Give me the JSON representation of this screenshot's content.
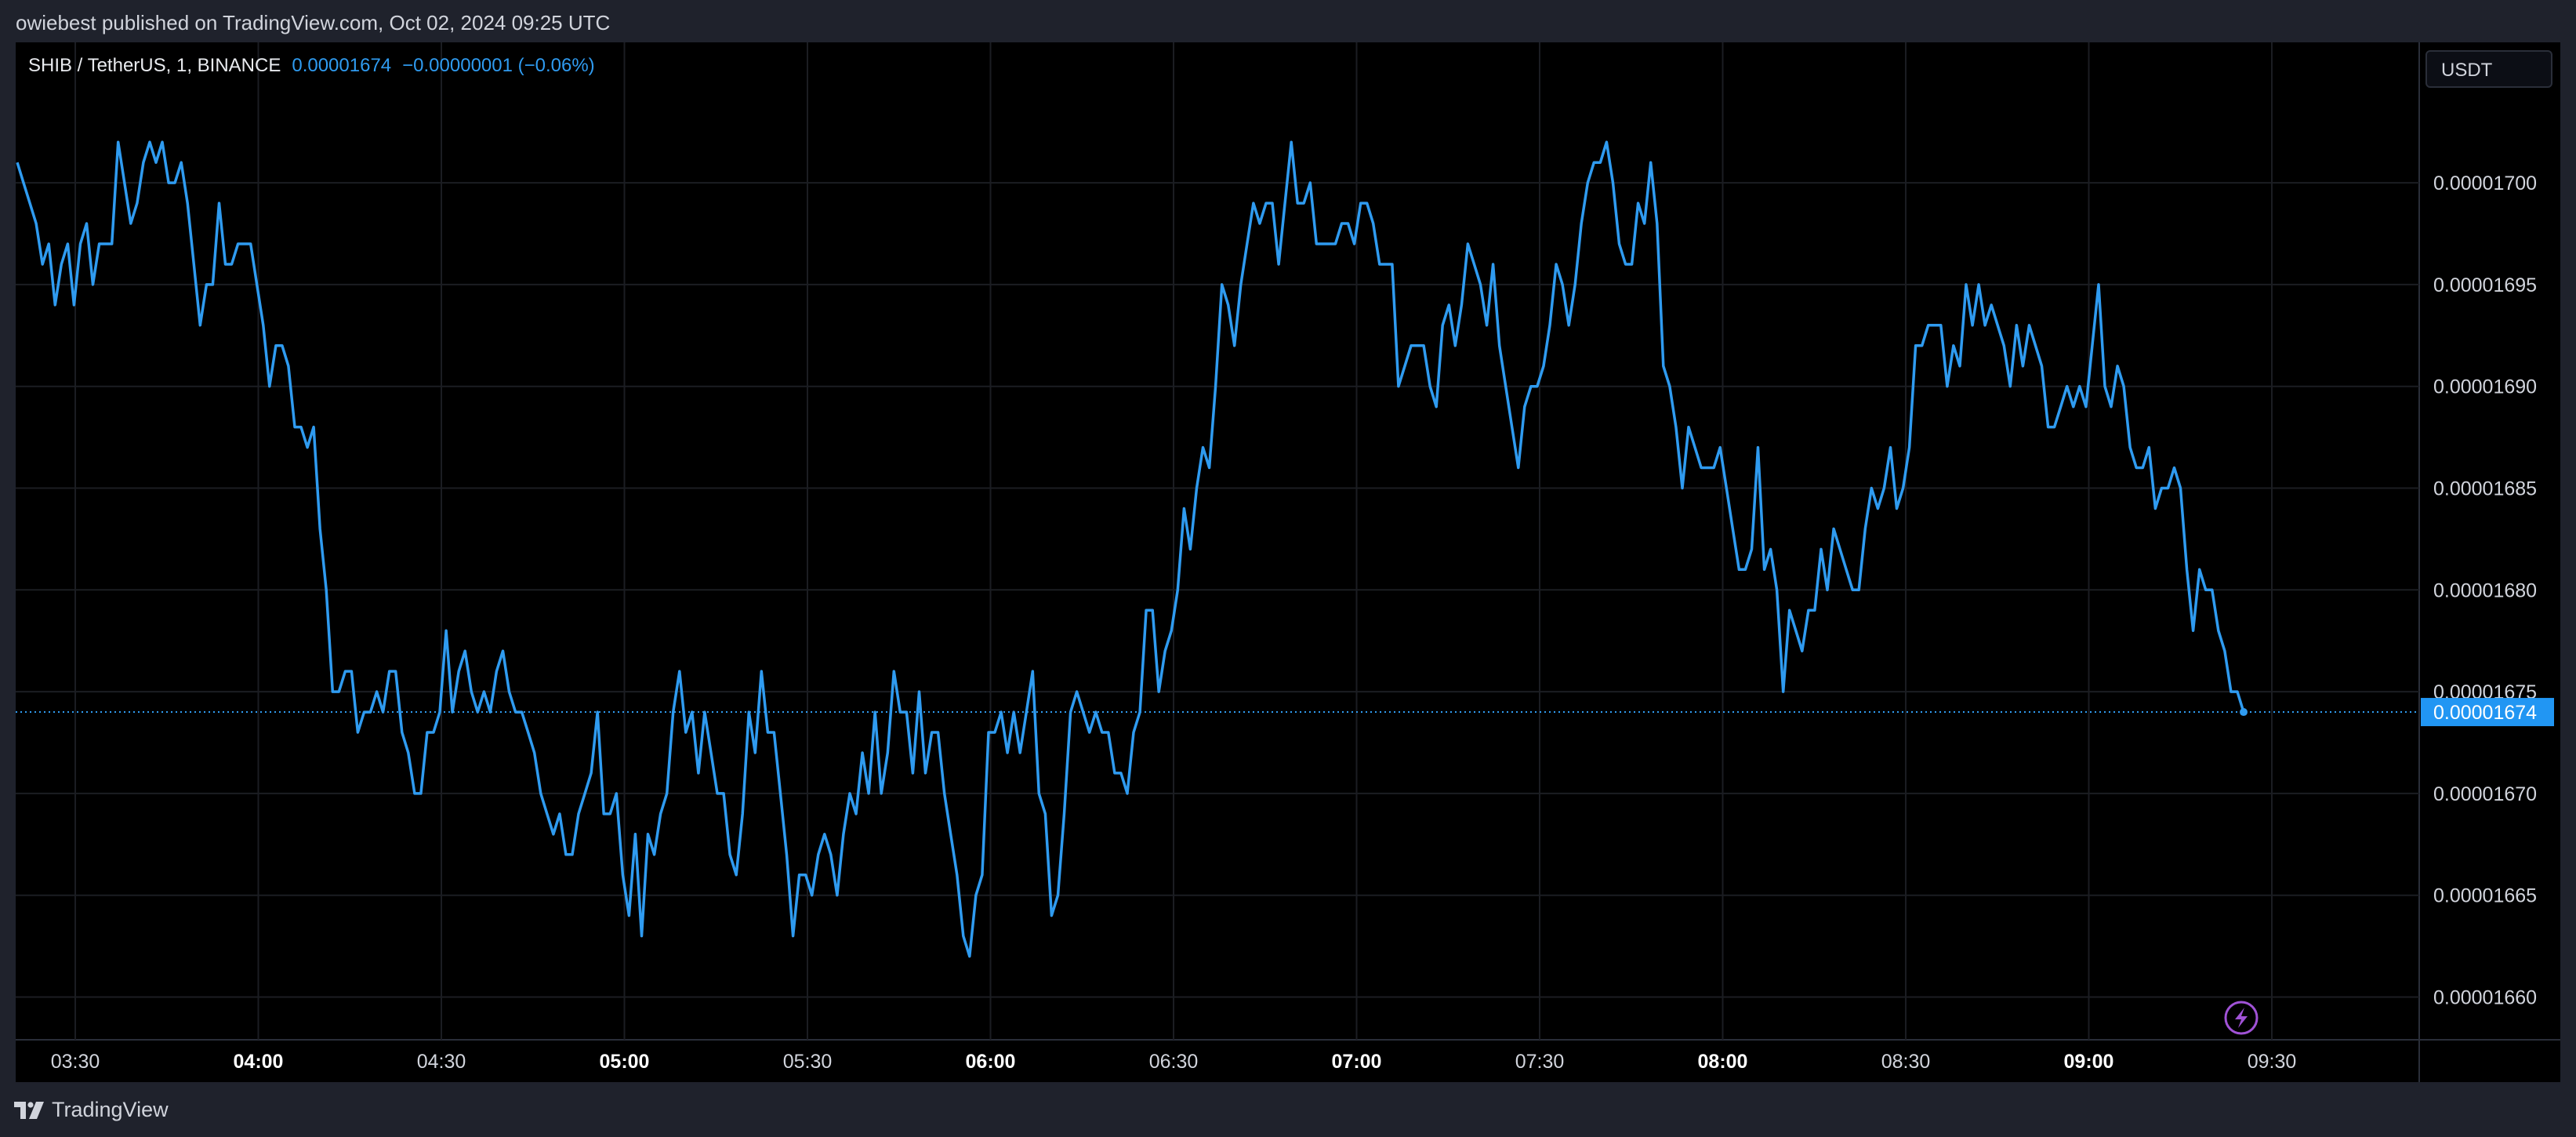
{
  "header": {
    "publisher_text": "owiebest published on TradingView.com, Oct 02, 2024 09:25 UTC"
  },
  "legend": {
    "symbol": "SHIB / TetherUS, 1, BINANCE",
    "price": "0.00001674",
    "change": "−0.00000001 (−0.06%)"
  },
  "currency": "USDT",
  "footer": {
    "brand": "TradingView"
  },
  "colors": {
    "line": "#2f9bf0",
    "background": "#000000",
    "grid": "#1b1d22",
    "price_tag": "#2196f3",
    "lightning": "#a052d6"
  },
  "chart_data": {
    "type": "line",
    "series": [
      {
        "values": [
          1701,
          1700,
          1699,
          1698,
          1696,
          1697,
          1694,
          1696,
          1697,
          1694,
          1697,
          1698,
          1695,
          1697,
          1697,
          1697,
          1702,
          1700,
          1698,
          1699,
          1701,
          1702,
          1701,
          1702,
          1700,
          1700,
          1701,
          1699,
          1696,
          1693,
          1695,
          1695,
          1699,
          1696,
          1696,
          1697,
          1697,
          1697,
          1695,
          1693,
          1690,
          1692,
          1692,
          1691,
          1688,
          1688,
          1687,
          1688,
          1683,
          1680,
          1675,
          1675,
          1676,
          1676,
          1673,
          1674,
          1674,
          1675,
          1674,
          1676,
          1676,
          1673,
          1672,
          1670,
          1670,
          1673,
          1673,
          1674,
          1678,
          1674,
          1676,
          1677,
          1675,
          1674,
          1675,
          1674,
          1676,
          1677,
          1675,
          1674,
          1674,
          1673,
          1672,
          1670,
          1669,
          1668,
          1669,
          1667,
          1667,
          1669,
          1670,
          1671,
          1674,
          1669,
          1669,
          1670,
          1666,
          1664,
          1668,
          1663,
          1668,
          1667,
          1669,
          1670,
          1674,
          1676,
          1673,
          1674,
          1671,
          1674,
          1672,
          1670,
          1670,
          1667,
          1666,
          1669,
          1674,
          1672,
          1676,
          1673,
          1673,
          1670,
          1667,
          1663,
          1666,
          1666,
          1665,
          1667,
          1668,
          1667,
          1665,
          1668,
          1670,
          1669,
          1672,
          1670,
          1674,
          1670,
          1672,
          1676,
          1674,
          1674,
          1671,
          1675,
          1671,
          1673,
          1673,
          1670,
          1668,
          1666,
          1663,
          1662,
          1665,
          1666,
          1673,
          1673,
          1674,
          1672,
          1674,
          1672,
          1674,
          1676,
          1670,
          1669,
          1664,
          1665,
          1669,
          1674,
          1675,
          1674,
          1673,
          1674,
          1673,
          1673,
          1671,
          1671,
          1670,
          1673,
          1674,
          1679,
          1679,
          1675,
          1677,
          1678,
          1680,
          1684,
          1682,
          1685,
          1687,
          1686,
          1690,
          1695,
          1694,
          1692,
          1695,
          1697,
          1699,
          1698,
          1699,
          1699,
          1696,
          1699,
          1702,
          1699,
          1699,
          1700,
          1697,
          1697,
          1697,
          1697,
          1698,
          1698,
          1697,
          1699,
          1699,
          1698,
          1696,
          1696,
          1696,
          1690,
          1691,
          1692,
          1692,
          1692,
          1690,
          1689,
          1693,
          1694,
          1692,
          1694,
          1697,
          1696,
          1695,
          1693,
          1696,
          1692,
          1690,
          1688,
          1686,
          1689,
          1690,
          1690,
          1691,
          1693,
          1696,
          1695,
          1693,
          1695,
          1698,
          1700,
          1701,
          1701,
          1702,
          1700,
          1697,
          1696,
          1696,
          1699,
          1698,
          1701,
          1698,
          1691,
          1690,
          1688,
          1685,
          1688,
          1687,
          1686,
          1686,
          1686,
          1687,
          1685,
          1683,
          1681,
          1681,
          1682,
          1687,
          1681,
          1682,
          1680,
          1675,
          1679,
          1678,
          1677,
          1679,
          1679,
          1682,
          1680,
          1683,
          1682,
          1681,
          1680,
          1680,
          1683,
          1685,
          1684,
          1685,
          1687,
          1684,
          1685,
          1687,
          1692,
          1692,
          1693,
          1693,
          1693,
          1690,
          1692,
          1691,
          1695,
          1693,
          1695,
          1693,
          1694,
          1693,
          1692,
          1690,
          1693,
          1691,
          1693,
          1692,
          1691,
          1688,
          1688,
          1689,
          1690,
          1689,
          1690,
          1689,
          1692,
          1695,
          1690,
          1689,
          1691,
          1690,
          1687,
          1686,
          1686,
          1687,
          1684,
          1685,
          1685,
          1686,
          1685,
          1681,
          1678,
          1681,
          1680,
          1680,
          1678,
          1677,
          1675,
          1675,
          1674
        ]
      }
    ],
    "y_ticks": [
      "0.00001660",
      "0.00001665",
      "0.00001670",
      "0.00001675",
      "0.00001680",
      "0.00001685",
      "0.00001690",
      "0.00001695",
      "0.00001700"
    ],
    "ylim": [
      1.6579e-05,
      1.7069e-05
    ],
    "x_ticks": [
      {
        "label": "03:30",
        "bold": false
      },
      {
        "label": "04:00",
        "bold": true
      },
      {
        "label": "04:30",
        "bold": false
      },
      {
        "label": "05:00",
        "bold": true
      },
      {
        "label": "05:30",
        "bold": false
      },
      {
        "label": "06:00",
        "bold": true
      },
      {
        "label": "06:30",
        "bold": false
      },
      {
        "label": "07:00",
        "bold": true
      },
      {
        "label": "07:30",
        "bold": false
      },
      {
        "label": "08:00",
        "bold": true
      },
      {
        "label": "08:30",
        "bold": false
      },
      {
        "label": "09:00",
        "bold": true
      },
      {
        "label": "09:30",
        "bold": false
      }
    ],
    "last_price_label": "0.00001674",
    "grid": true
  }
}
